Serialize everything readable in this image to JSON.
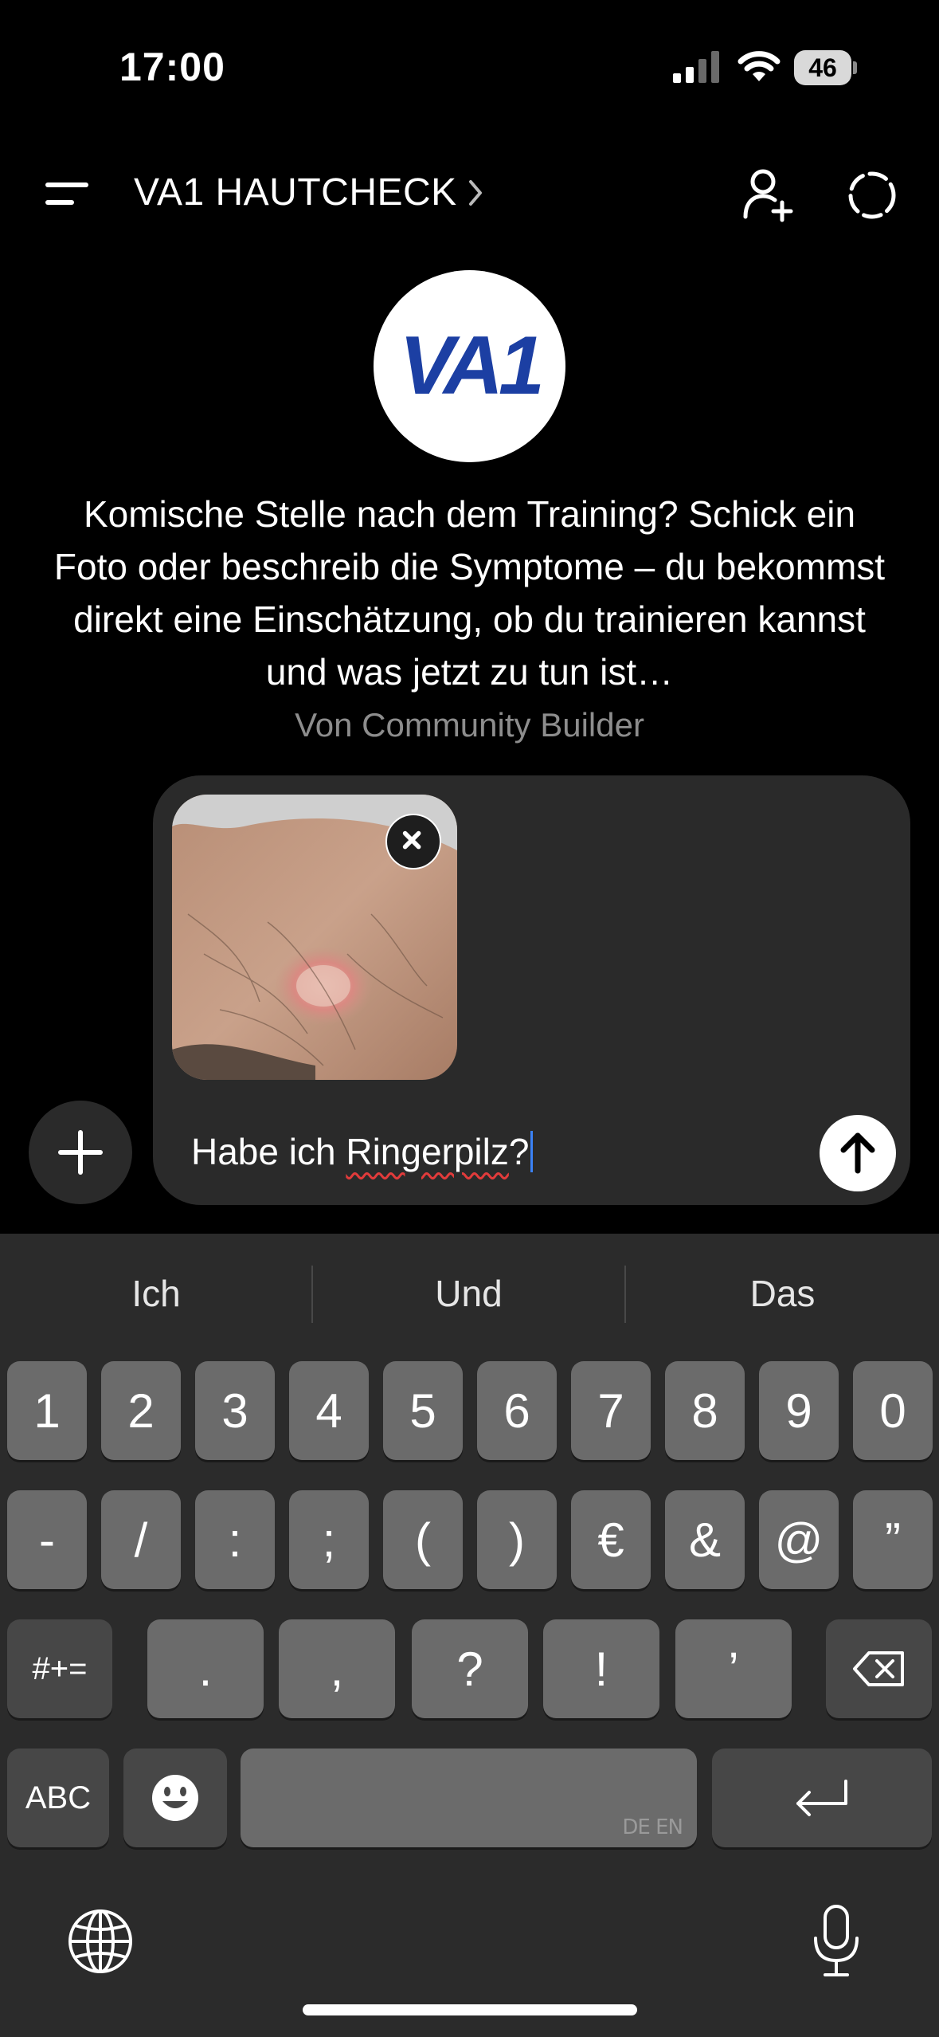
{
  "status_bar": {
    "time": "17:00",
    "battery": "46"
  },
  "header": {
    "title": "VA1 HAUTCHECK"
  },
  "bot": {
    "logo_text": "VA1",
    "description": "Komische Stelle nach dem Training? Schick ein Foto oder beschreib die Symptome – du bekommst direkt eine Einschätzung, ob du trainieren kannst und was jetzt zu tun ist…",
    "byline": "Von Community Builder"
  },
  "composer": {
    "message_prefix": "Habe ich ",
    "message_misspelled": "Ringerpilz",
    "message_suffix": "?"
  },
  "keyboard": {
    "suggestions": [
      "Ich",
      "Und",
      "Das"
    ],
    "row1": [
      "1",
      "2",
      "3",
      "4",
      "5",
      "6",
      "7",
      "8",
      "9",
      "0"
    ],
    "row2": [
      "-",
      "/",
      ":",
      ";",
      "(",
      ")",
      "€",
      "&",
      "@",
      "”"
    ],
    "row3": [
      ".",
      ",",
      "?",
      "!",
      "’"
    ],
    "mode_key": "#+=",
    "abc_key": "ABC",
    "space_lang": "DE EN"
  }
}
